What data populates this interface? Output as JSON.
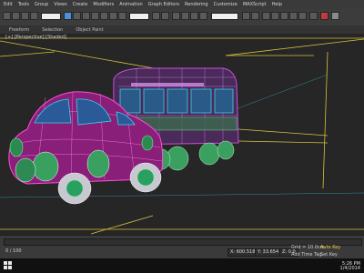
{
  "menu": [
    "Edit",
    "Tools",
    "Group",
    "Views",
    "Create",
    "Modifiers",
    "Animation",
    "Graph Editors",
    "Rendering",
    "Customize",
    "MAXScript",
    "Help"
  ],
  "ribbon": [
    "Freeform",
    "Selection",
    "Object Paint"
  ],
  "viewport": {
    "label": "[+] [Perspective] [Shaded]"
  },
  "status": {
    "frames": "0 / 100",
    "x": "X: 600.518",
    "y": "Y: 33.654",
    "z": "Z: 0.0",
    "grid": "Grid = 10.0cm",
    "add_time_tag": "Add Time Tag",
    "auto_key": "Auto Key",
    "set_key": "Set Key"
  },
  "taskbar": {
    "time": "5:26 PM",
    "date": "1/4/2014"
  },
  "colors": {
    "bg": "#2b2b2b",
    "grid_yellow": "#d8c23a",
    "wire_magenta": "#d21fd2",
    "wire_cyan": "#38d4e8"
  }
}
